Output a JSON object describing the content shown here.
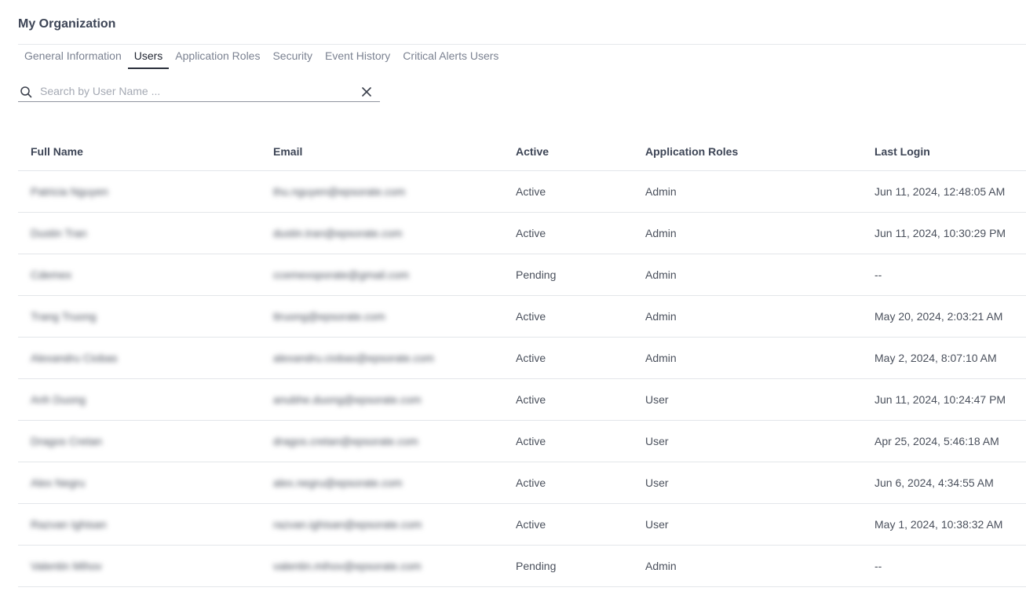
{
  "page": {
    "title": "My Organization"
  },
  "tabs": [
    {
      "label": "General Information",
      "active": false
    },
    {
      "label": "Users",
      "active": true
    },
    {
      "label": "Application Roles",
      "active": false
    },
    {
      "label": "Security",
      "active": false
    },
    {
      "label": "Event History",
      "active": false
    },
    {
      "label": "Critical Alerts Users",
      "active": false
    }
  ],
  "search": {
    "placeholder": "Search by User Name ...",
    "value": "",
    "icon": "search-icon",
    "clear_icon": "close-icon"
  },
  "table": {
    "columns": [
      "Full Name",
      "Email",
      "Active",
      "Application Roles",
      "Last Login"
    ],
    "rows": [
      {
        "name": "Patricia Nguyen",
        "email": "thu.nguyen@epsorate.com",
        "active": "Active",
        "role": "Admin",
        "last_login": "Jun 11, 2024, 12:48:05 AM"
      },
      {
        "name": "Dustin Tran",
        "email": "dustin.tran@epsorate.com",
        "active": "Active",
        "role": "Admin",
        "last_login": "Jun 11, 2024, 10:30:29 PM"
      },
      {
        "name": "Cdemex",
        "email": "ccemexsporate@gmail.com",
        "active": "Pending",
        "role": "Admin",
        "last_login": "--"
      },
      {
        "name": "Trang Truong",
        "email": "ttruong@epsorate.com",
        "active": "Active",
        "role": "Admin",
        "last_login": "May 20, 2024, 2:03:21 AM"
      },
      {
        "name": "Alexandru Ciobas",
        "email": "alexandru.ciobas@epsorate.com",
        "active": "Active",
        "role": "Admin",
        "last_login": "May 2, 2024, 8:07:10 AM"
      },
      {
        "name": "Anh Duong",
        "email": "anubhe.duong@epsorate.com",
        "active": "Active",
        "role": "User",
        "last_login": "Jun 11, 2024, 10:24:47 PM"
      },
      {
        "name": "Dragos Cretan",
        "email": "dragos.cretan@epsorate.com",
        "active": "Active",
        "role": "User",
        "last_login": "Apr 25, 2024, 5:46:18 AM"
      },
      {
        "name": "Alex Negru",
        "email": "alex.negru@epsorate.com",
        "active": "Active",
        "role": "User",
        "last_login": "Jun 6, 2024, 4:34:55 AM"
      },
      {
        "name": "Razvan Ighisan",
        "email": "razvan.ighisan@epsorate.com",
        "active": "Active",
        "role": "User",
        "last_login": "May 1, 2024, 10:38:32 AM"
      },
      {
        "name": "Valentin Mihov",
        "email": "valentin.mihov@epsorate.com",
        "active": "Pending",
        "role": "Admin",
        "last_login": "--"
      }
    ]
  },
  "colors": {
    "active": "#3a8a35",
    "pending": "#f0a23a"
  }
}
